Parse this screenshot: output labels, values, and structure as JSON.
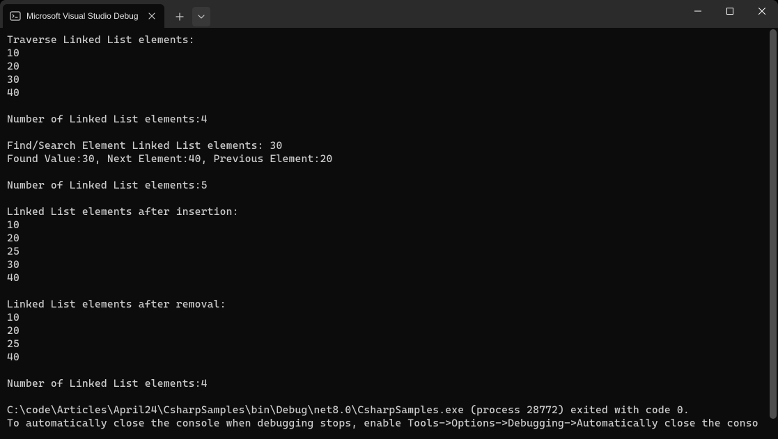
{
  "window": {
    "tab_title": "Microsoft Visual Studio Debug"
  },
  "console": {
    "output": "Traverse Linked List elements:\n10\n20\n30\n40\n\nNumber of Linked List elements:4\n\nFind/Search Element Linked List elements: 30\nFound Value:30, Next Element:40, Previous Element:20\n\nNumber of Linked List elements:5\n\nLinked List elements after insertion:\n10\n20\n25\n30\n40\n\nLinked List elements after removal:\n10\n20\n25\n40\n\nNumber of Linked List elements:4\n\nC:\\code\\Articles\\April24\\CsharpSamples\\bin\\Debug\\net8.0\\CsharpSamples.exe (process 28772) exited with code 0.\nTo automatically close the console when debugging stops, enable Tools->Options->Debugging->Automatically close the conso"
  }
}
